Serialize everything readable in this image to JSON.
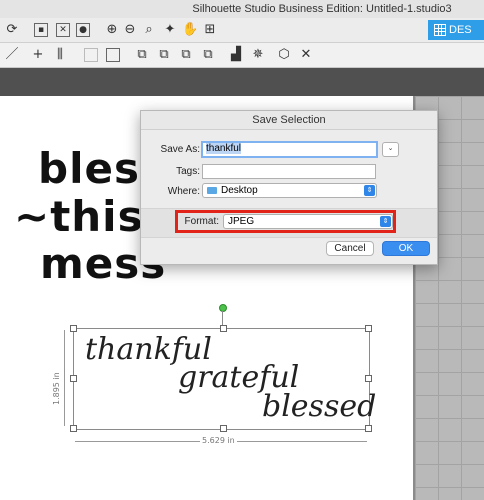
{
  "window": {
    "title": "Silhouette Studio Business Edition: Untitled-1.studio3"
  },
  "toolbar": {
    "design_label": "DES",
    "icons_row1": [
      "refresh-icon",
      "select-all-icon",
      "deselect-icon",
      "select-icon",
      "zoom-in-icon",
      "zoom-out-icon",
      "zoom-fit-icon",
      "move-icon",
      "pan-icon",
      "grid-icon"
    ],
    "icons_row2": [
      "line-icon",
      "point-icon",
      "align-icon",
      "group-icon",
      "ungroup-icon",
      "replicate-icon",
      "nest-icon",
      "offset-icon",
      "bring-front-icon",
      "send-back-icon",
      "weld-icon",
      "star-icon",
      "trace-icon",
      "close-icon"
    ]
  },
  "dialog": {
    "title": "Save Selection",
    "save_as_label": "Save As:",
    "save_as_value": "thankful",
    "tags_label": "Tags:",
    "tags_value": "",
    "where_label": "Where:",
    "where_value": "Desktop",
    "format_label": "Format:",
    "format_value": "JPEG",
    "cancel_label": "Cancel",
    "ok_label": "OK"
  },
  "canvas": {
    "design_text": [
      "bless",
      "~this~",
      "mess"
    ],
    "script_words": [
      "thankful",
      "grateful",
      "blessed"
    ],
    "height_label": "1.895 in",
    "width_label": "5.629 in"
  },
  "colors": {
    "accent": "#2f9ee8",
    "highlight": "#e2231a",
    "ok_button": "#3a8ef0"
  }
}
